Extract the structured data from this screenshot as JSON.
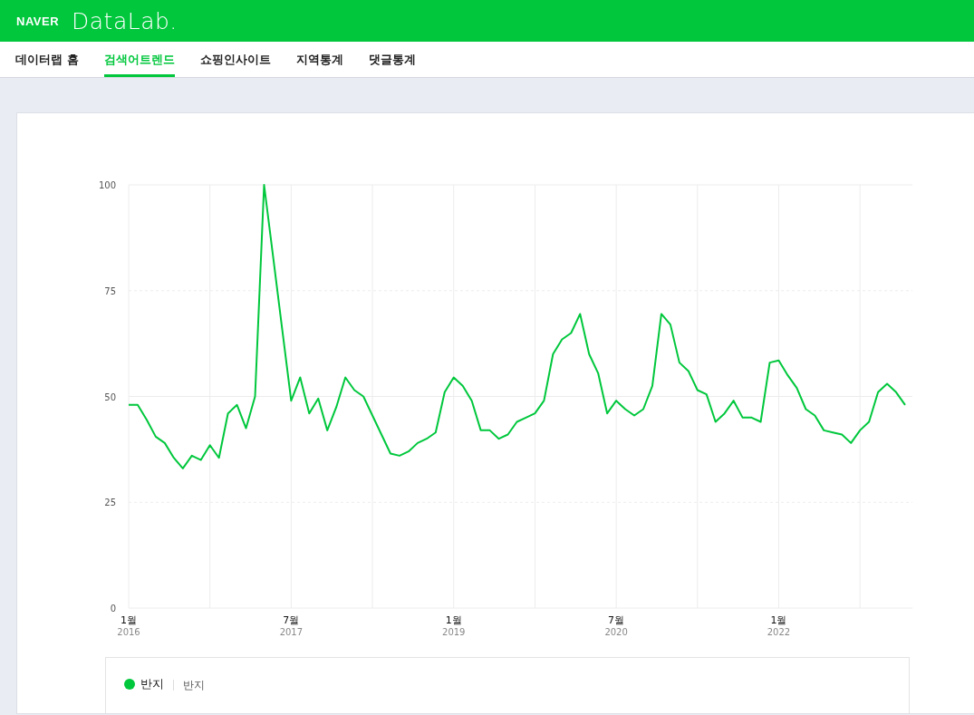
{
  "header": {
    "brand": "NAVER",
    "product": "DataLab."
  },
  "nav": [
    {
      "label": "데이터랩 홈",
      "selected": false
    },
    {
      "label": "검색어트렌드",
      "selected": true
    },
    {
      "label": "쇼핑인사이트",
      "selected": false
    },
    {
      "label": "지역통계",
      "selected": false
    },
    {
      "label": "댓글통계",
      "selected": false
    }
  ],
  "chart": {
    "chart_data": {
      "type": "line",
      "grid": true,
      "ylim": [
        0,
        100
      ],
      "yticks": [
        0,
        25,
        50,
        75,
        100
      ],
      "categories": [
        "1월 2016",
        null,
        null,
        null,
        null,
        null,
        null,
        null,
        null,
        null,
        null,
        null,
        null,
        null,
        null,
        null,
        null,
        null,
        "7월 2017",
        null,
        null,
        null,
        null,
        null,
        null,
        null,
        null,
        null,
        null,
        null,
        null,
        null,
        null,
        null,
        null,
        null,
        "1월 2019",
        null,
        null,
        null,
        null,
        null,
        null,
        null,
        null,
        null,
        null,
        null,
        null,
        null,
        null,
        null,
        null,
        null,
        "7월 2020",
        null,
        null,
        null,
        null,
        null,
        null,
        null,
        null,
        null,
        null,
        null,
        null,
        null,
        null,
        null,
        null,
        null,
        "1월 2022",
        null,
        null,
        null,
        null,
        null,
        null,
        null,
        null,
        null,
        null,
        null,
        null,
        null,
        null
      ],
      "series": [
        {
          "name": "반지",
          "color": "#00c73c",
          "values": [
            48,
            48,
            44.5,
            40.5,
            39,
            35.5,
            33,
            36,
            35,
            38.5,
            35.5,
            46,
            48,
            42.5,
            50,
            100,
            83,
            66,
            49,
            54.5,
            46,
            49.5,
            42,
            47.5,
            54.5,
            51.5,
            50,
            45.5,
            41,
            36.5,
            36,
            37,
            39,
            40,
            41.5,
            51,
            54.5,
            52.5,
            49,
            42,
            42,
            40,
            41,
            44,
            45,
            46,
            49,
            60,
            63.5,
            65,
            69.5,
            60,
            55.5,
            46,
            49,
            47,
            45.5,
            47,
            52.5,
            69.5,
            67,
            58,
            56,
            51.5,
            50.5,
            44,
            46,
            49,
            45,
            45,
            44,
            58,
            58.5,
            55,
            52,
            47,
            45.5,
            42,
            41.5,
            41,
            39,
            42,
            44,
            51,
            53,
            51,
            48
          ]
        }
      ]
    }
  },
  "legend": [
    {
      "detail": "반지"
    }
  ]
}
